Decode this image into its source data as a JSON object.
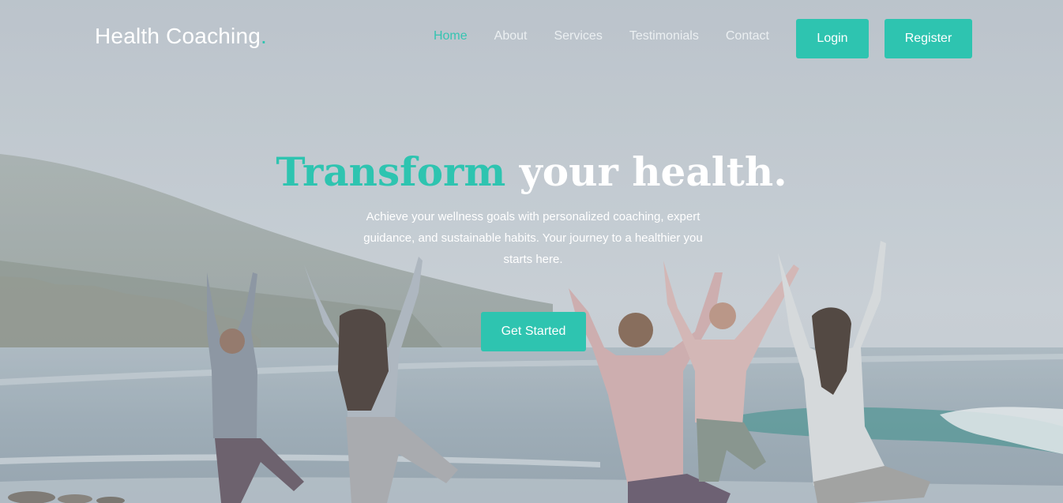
{
  "brand": {
    "name": "Health Coaching",
    "dot": "."
  },
  "nav": {
    "items": [
      {
        "label": "Home",
        "active": true
      },
      {
        "label": "About",
        "active": false
      },
      {
        "label": "Services",
        "active": false
      },
      {
        "label": "Testimonials",
        "active": false
      },
      {
        "label": "Contact",
        "active": false
      }
    ],
    "login_label": "Login",
    "register_label": "Register"
  },
  "hero": {
    "headline_accent": "Transform",
    "headline_rest": " your health.",
    "subtext": "Achieve your wellness goals with personalized coaching, expert guidance, and sustainable habits. Your journey to a healthier you starts here.",
    "cta_label": "Get Started",
    "background_description_icon": "yoga-beach-photo"
  },
  "colors": {
    "accent": "#2ec4b0",
    "text_light": "#ffffff"
  }
}
